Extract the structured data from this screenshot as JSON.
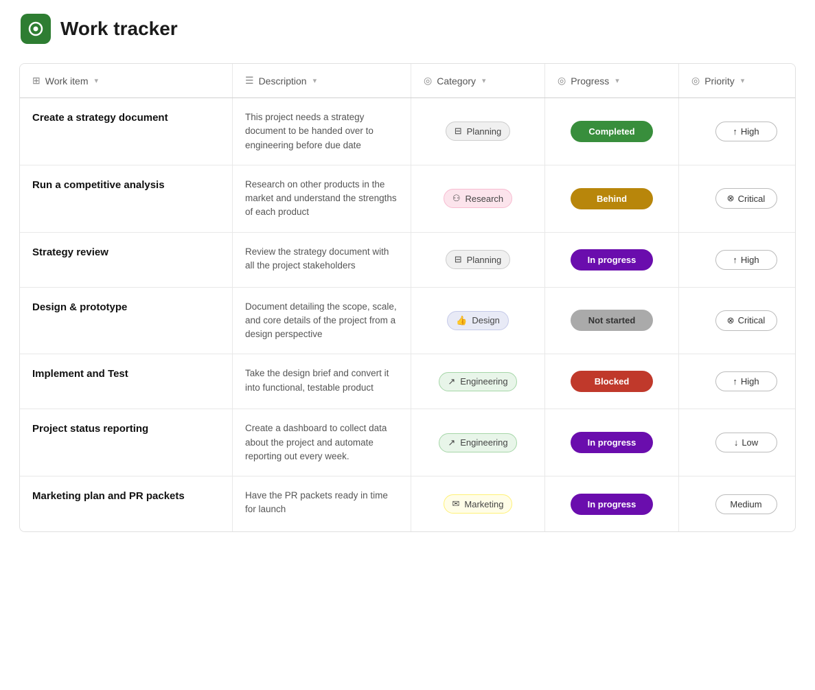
{
  "app": {
    "title": "Work tracker",
    "logo_alt": "Work tracker logo"
  },
  "table": {
    "columns": [
      {
        "id": "work-item",
        "label": "Work item",
        "icon": "table-icon"
      },
      {
        "id": "description",
        "label": "Description",
        "icon": "list-icon"
      },
      {
        "id": "category",
        "label": "Category",
        "icon": "check-circle-icon"
      },
      {
        "id": "progress",
        "label": "Progress",
        "icon": "check-circle-icon"
      },
      {
        "id": "priority",
        "label": "Priority",
        "icon": "check-circle-icon"
      }
    ],
    "rows": [
      {
        "work_item": "Create a strategy document",
        "description": "This project needs a strategy document to be handed over to engineering before due date",
        "category": "Planning",
        "category_type": "planning",
        "category_icon": "calendar-icon",
        "progress": "Completed",
        "progress_type": "completed",
        "priority": "High",
        "priority_type": "high",
        "priority_arrow": "up"
      },
      {
        "work_item": "Run a competitive analysis",
        "description": "Research on other products in the market and understand the strengths of each product",
        "category": "Research",
        "category_type": "research",
        "category_icon": "people-icon",
        "progress": "Behind",
        "progress_type": "behind",
        "priority": "Critical",
        "priority_type": "critical",
        "priority_arrow": "x"
      },
      {
        "work_item": "Strategy review",
        "description": "Review the strategy document with all the project stakeholders",
        "category": "Planning",
        "category_type": "planning",
        "category_icon": "calendar-icon",
        "progress": "In progress",
        "progress_type": "in-progress",
        "priority": "High",
        "priority_type": "high",
        "priority_arrow": "up"
      },
      {
        "work_item": "Design & prototype",
        "description": "Document detailing the scope, scale, and core details of the project from a design perspective",
        "category": "Design",
        "category_type": "design",
        "category_icon": "hand-icon",
        "progress": "Not started",
        "progress_type": "not-started",
        "priority": "Critical",
        "priority_type": "critical",
        "priority_arrow": "x"
      },
      {
        "work_item": "Implement and Test",
        "description": "Take the design brief and convert it into functional, testable product",
        "category": "Engineering",
        "category_type": "engineering",
        "category_icon": "trend-icon",
        "progress": "Blocked",
        "progress_type": "blocked",
        "priority": "High",
        "priority_type": "high",
        "priority_arrow": "up"
      },
      {
        "work_item": "Project status reporting",
        "description": "Create a dashboard to collect data about the project and automate reporting out every week.",
        "category": "Engineering",
        "category_type": "engineering",
        "category_icon": "trend-icon",
        "progress": "In progress",
        "progress_type": "in-progress",
        "priority": "Low",
        "priority_type": "low",
        "priority_arrow": "down"
      },
      {
        "work_item": "Marketing plan and PR packets",
        "description": "Have the PR packets ready in time for launch",
        "category": "Marketing",
        "category_type": "marketing",
        "category_icon": "mail-icon",
        "progress": "In progress",
        "progress_type": "in-progress",
        "priority": "Medium",
        "priority_type": "medium",
        "priority_arrow": "none"
      }
    ]
  }
}
